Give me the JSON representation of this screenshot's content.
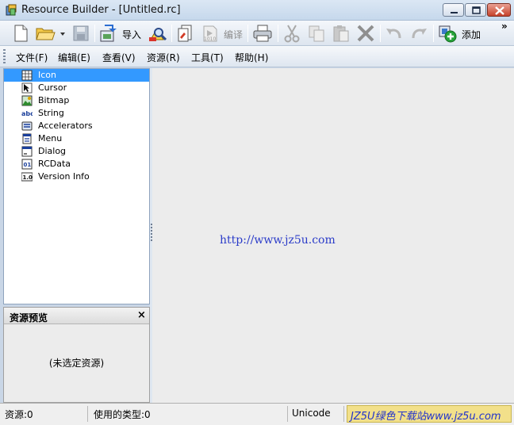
{
  "window": {
    "title": "Resource Builder - [Untitled.rc]"
  },
  "toolbar": {
    "import_label": "导入",
    "compile_label": "编译",
    "add_label": "添加",
    "overflow": "»"
  },
  "menu": [
    "文件(F)",
    "编辑(E)",
    "查看(V)",
    "资源(R)",
    "工具(T)",
    "帮助(H)"
  ],
  "tree": {
    "selected": "Icon",
    "items": [
      {
        "label": "Icon",
        "icon": "icon-resource-icon"
      },
      {
        "label": "Cursor",
        "icon": "cursor-resource-icon"
      },
      {
        "label": "Bitmap",
        "icon": "bitmap-resource-icon"
      },
      {
        "label": "String",
        "icon": "string-resource-icon"
      },
      {
        "label": "Accelerators",
        "icon": "accelerators-resource-icon"
      },
      {
        "label": "Menu",
        "icon": "menu-resource-icon"
      },
      {
        "label": "Dialog",
        "icon": "dialog-resource-icon"
      },
      {
        "label": "RCData",
        "icon": "rcdata-resource-icon"
      },
      {
        "label": "Version Info",
        "icon": "version-info-resource-icon"
      }
    ]
  },
  "preview": {
    "title": "资源预览",
    "close": "×",
    "empty_text": "(未选定资源)"
  },
  "content": {
    "watermark": "http://www.jz5u.com"
  },
  "status": {
    "resources": "资源:0",
    "types_used": "使用的类型:0",
    "encoding": "Unicode",
    "badge": "JZ5U绿色下载站www.jz5u.com"
  },
  "colors": {
    "selection": "#3399ff",
    "watermark": "#2b3cc9",
    "badge_bg": "#f2e08a"
  }
}
